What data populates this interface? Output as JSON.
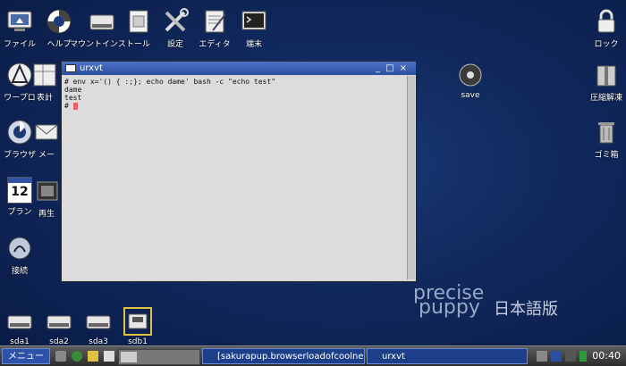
{
  "desktop_icons_top": [
    {
      "id": "file",
      "label": "ファイル"
    },
    {
      "id": "help",
      "label": "ヘルプ"
    },
    {
      "id": "mount",
      "label": "マウントインストール"
    },
    {
      "id": "settings",
      "label": "設定"
    },
    {
      "id": "editor",
      "label": "エディタ"
    },
    {
      "id": "terminal",
      "label": "端末"
    }
  ],
  "desktop_icons_left": [
    {
      "id": "wordpro",
      "label": "ワープロ"
    },
    {
      "id": "browser",
      "label": "ブラウザ"
    },
    {
      "id": "plan",
      "label": "プラン"
    },
    {
      "id": "connect",
      "label": "接続"
    }
  ],
  "partial_labels": {
    "sheet": "表計",
    "mail": "メー",
    "player": "再生"
  },
  "desktop_icons_right": {
    "lock": "ロック",
    "compress": "圧縮解凍",
    "trash": "ゴミ箱"
  },
  "save_label": "save",
  "drives": [
    "sda1",
    "sda2",
    "sda3",
    "sdb1"
  ],
  "calendar_day": "12",
  "window": {
    "title": "urxvt",
    "lines": [
      "# env x='() { :;}; echo dame' bash -c \"echo test\"",
      "dame",
      "test",
      "# "
    ]
  },
  "brand": {
    "line1": "precise",
    "line2": "puppy",
    "line3": "日本語版"
  },
  "taskbar": {
    "menu_label": "メニュー",
    "task1": "[sakurapup.browserloadofcoolne",
    "task2": "urxvt",
    "clock": "00:40"
  },
  "colors": {
    "desktop": "#10285c",
    "titlebar": "#2a4f9e",
    "cursor": "#f06060"
  }
}
